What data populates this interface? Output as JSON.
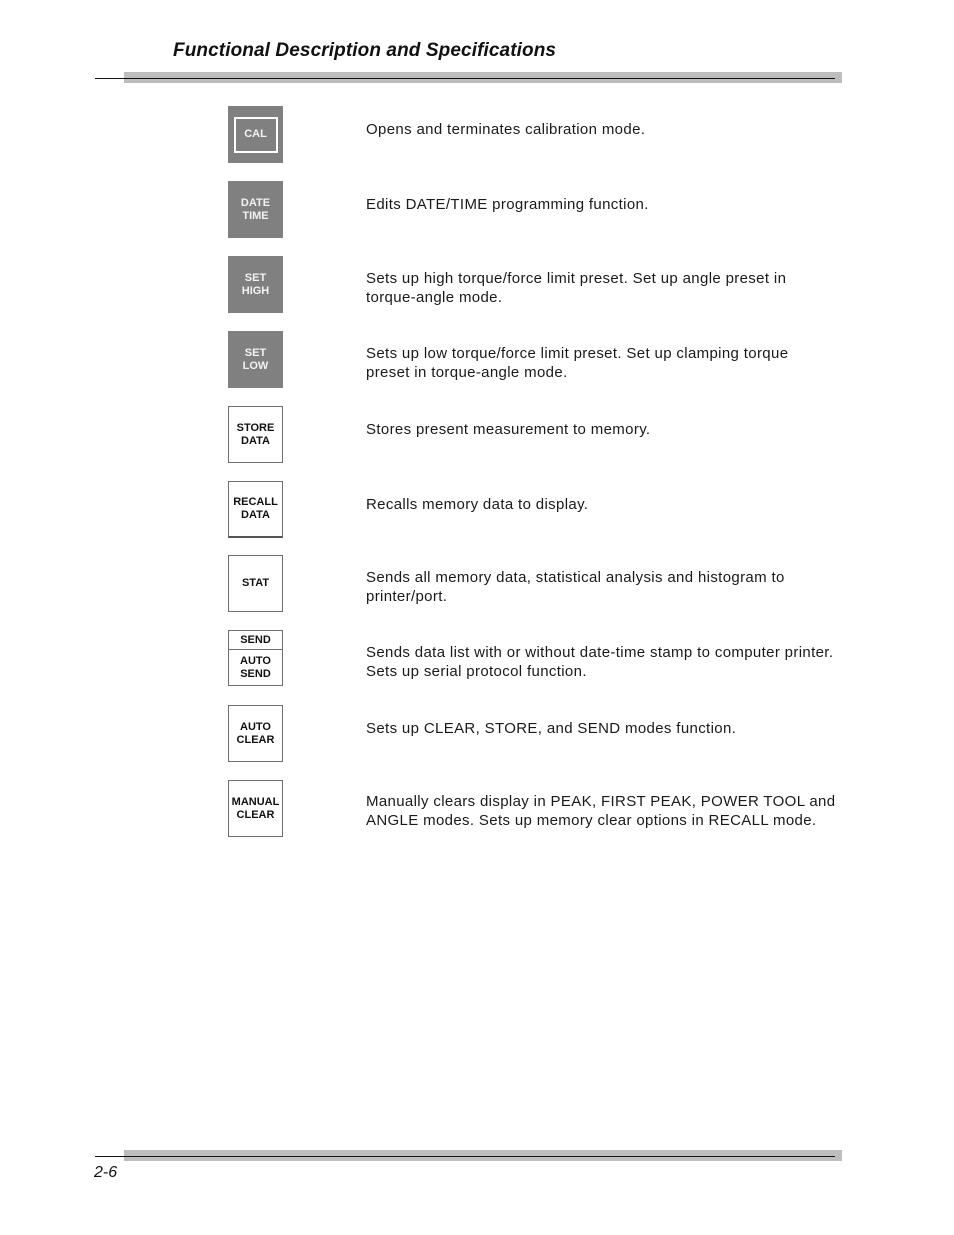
{
  "header": {
    "title": "Functional Description and Specifications"
  },
  "footer": {
    "page_number": "2-6"
  },
  "keys": [
    {
      "id": "cal",
      "label_lines": [
        "CAL"
      ],
      "style": "dark-framed",
      "description": "Opens and terminates calibration mode."
    },
    {
      "id": "date-time",
      "label_lines": [
        "DATE",
        "TIME"
      ],
      "style": "dark",
      "description": "Edits DATE/TIME programming function."
    },
    {
      "id": "set-high",
      "label_lines": [
        "SET",
        "HIGH"
      ],
      "style": "dark",
      "description": "Sets up high torque/force limit preset.  Set up angle preset in torque-angle mode."
    },
    {
      "id": "set-low",
      "label_lines": [
        "SET",
        "LOW"
      ],
      "style": "dark",
      "description": "Sets up low torque/force limit preset.  Set up clamping torque preset in torque-angle mode."
    },
    {
      "id": "store-data",
      "label_lines": [
        "STORE",
        "DATA"
      ],
      "style": "light",
      "description": "Stores present measurement to memory."
    },
    {
      "id": "recall-data",
      "label_lines": [
        "RECALL",
        "DATA"
      ],
      "style": "light",
      "description": "Recalls memory data to display."
    },
    {
      "id": "stat",
      "label_lines": [
        "STAT"
      ],
      "style": "light",
      "description": "Sends all memory data, statistical analysis and histogram to printer/port."
    },
    {
      "id": "send-auto-send",
      "label_top": "SEND",
      "label_lines": [
        "AUTO",
        "SEND"
      ],
      "style": "split",
      "description": "Sends data list with or without date-time stamp to computer printer.  Sets up serial protocol function."
    },
    {
      "id": "auto-clear",
      "label_lines": [
        "AUTO",
        "CLEAR"
      ],
      "style": "light",
      "description": "Sets up CLEAR, STORE, and SEND modes function."
    },
    {
      "id": "manual-clear",
      "label_lines": [
        "MANUAL",
        "CLEAR"
      ],
      "style": "light",
      "description": "Manually clears display in PEAK, FIRST PEAK, POWER TOOL and ANGLE modes.  Sets up memory clear options in RECALL mode."
    }
  ]
}
